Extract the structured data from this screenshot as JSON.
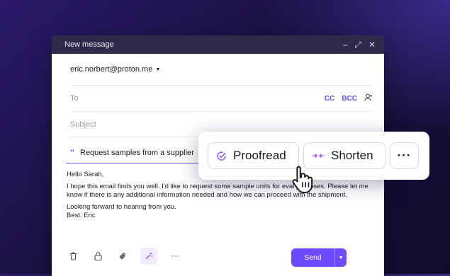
{
  "window": {
    "title": "New message"
  },
  "from": {
    "address": "eric.norbert@proton.me"
  },
  "recipients": {
    "to_label": "To",
    "cc_label": "CC",
    "bcc_label": "BCC"
  },
  "subject": {
    "placeholder": "Subject"
  },
  "ai_prompt": {
    "text": "Request samples from a supplier"
  },
  "body": {
    "greeting": "Hello Sarah,",
    "para1": "I hope this email finds you well. I'd like to request some sample units for eval        purposes. Please let me know if there is any additional information needed and how we can proceed with the shipment.",
    "closing1": "Looking forward to hearing from you.",
    "closing2": "Best. Eric"
  },
  "send": {
    "label": "Send"
  },
  "ai_actions": {
    "proofread": "Proofread",
    "shorten": "Shorten",
    "more": "···"
  },
  "colors": {
    "accent": "#6d4aff",
    "ai_accent": "#8c4bff",
    "titlebar": "#2f2a4a"
  }
}
